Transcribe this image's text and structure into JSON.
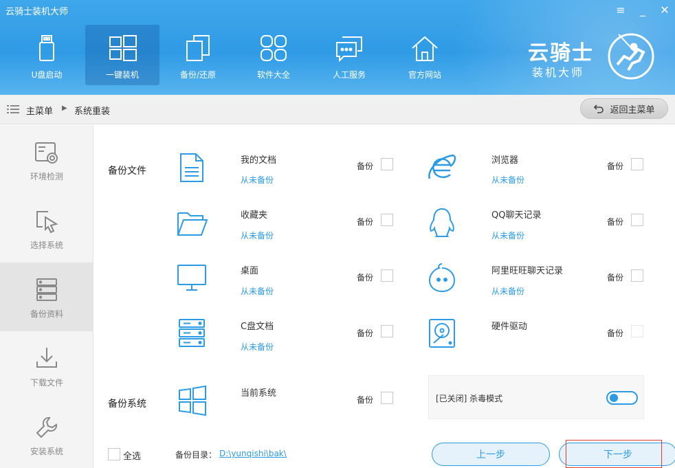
{
  "window": {
    "title": "云骑士装机大师",
    "controls": {
      "menu": "≡",
      "minimize": "_",
      "close": "✕"
    }
  },
  "nav": {
    "items": [
      {
        "label": "U盘启动",
        "icon": "usb-icon"
      },
      {
        "label": "一键装机",
        "icon": "windows-icon"
      },
      {
        "label": "备份/还原",
        "icon": "backup-icon"
      },
      {
        "label": "软件大全",
        "icon": "apps-grid-icon"
      },
      {
        "label": "人工服务",
        "icon": "chat-icon"
      },
      {
        "label": "官方网站",
        "icon": "home-icon"
      }
    ],
    "active": 1
  },
  "logo": {
    "main": "云骑士",
    "sub": "装机大师"
  },
  "breadcrumb": {
    "root": "主菜单",
    "current": "系统重装",
    "separator": "▶"
  },
  "back_button": {
    "label": "返回主菜单"
  },
  "sidebar": {
    "items": [
      {
        "label": "环境检测",
        "icon": "environment-check-icon"
      },
      {
        "label": "选择系统",
        "icon": "select-cursor-icon"
      },
      {
        "label": "备份资料",
        "icon": "server-stack-icon"
      },
      {
        "label": "下载文件",
        "icon": "download-icon"
      },
      {
        "label": "安装系统",
        "icon": "wrench-icon"
      }
    ],
    "active": 2
  },
  "backup_files": {
    "label": "备份文件",
    "backup_label": "备份",
    "items": [
      {
        "name": "我的文档",
        "status": "从未备份",
        "icon": "document-icon"
      },
      {
        "name": "浏览器",
        "status": "从未备份",
        "icon": "ie-browser-icon"
      },
      {
        "name": "收藏夹",
        "status": "从未备份",
        "icon": "folder-icon"
      },
      {
        "name": "QQ聊天记录",
        "status": "从未备份",
        "icon": "qq-penguin-icon"
      },
      {
        "name": "桌面",
        "status": "从未备份",
        "icon": "monitor-icon"
      },
      {
        "name": "阿里旺旺聊天记录",
        "status": "从未备份",
        "icon": "aliwangwang-icon"
      },
      {
        "name": "C盘文档",
        "status": "从未备份",
        "icon": "server-drive-icon"
      },
      {
        "name": "硬件驱动",
        "status": "",
        "icon": "hard-disk-icon"
      }
    ]
  },
  "backup_system": {
    "label": "备份系统",
    "item": {
      "name": "当前系统",
      "backup_label": "备份",
      "icon": "windows-icon"
    },
    "antivirus": {
      "label": "[已关闭] 杀毒模式"
    }
  },
  "footer": {
    "select_all": "全选",
    "dir_label": "备份目录：",
    "dir_path": "D:\\yunqishi\\bak\\",
    "prev": "上一步",
    "next": "下一步"
  },
  "colors": {
    "accent": "#2b9be6",
    "header": "#3fa6ea",
    "highlight": "#e53935"
  }
}
